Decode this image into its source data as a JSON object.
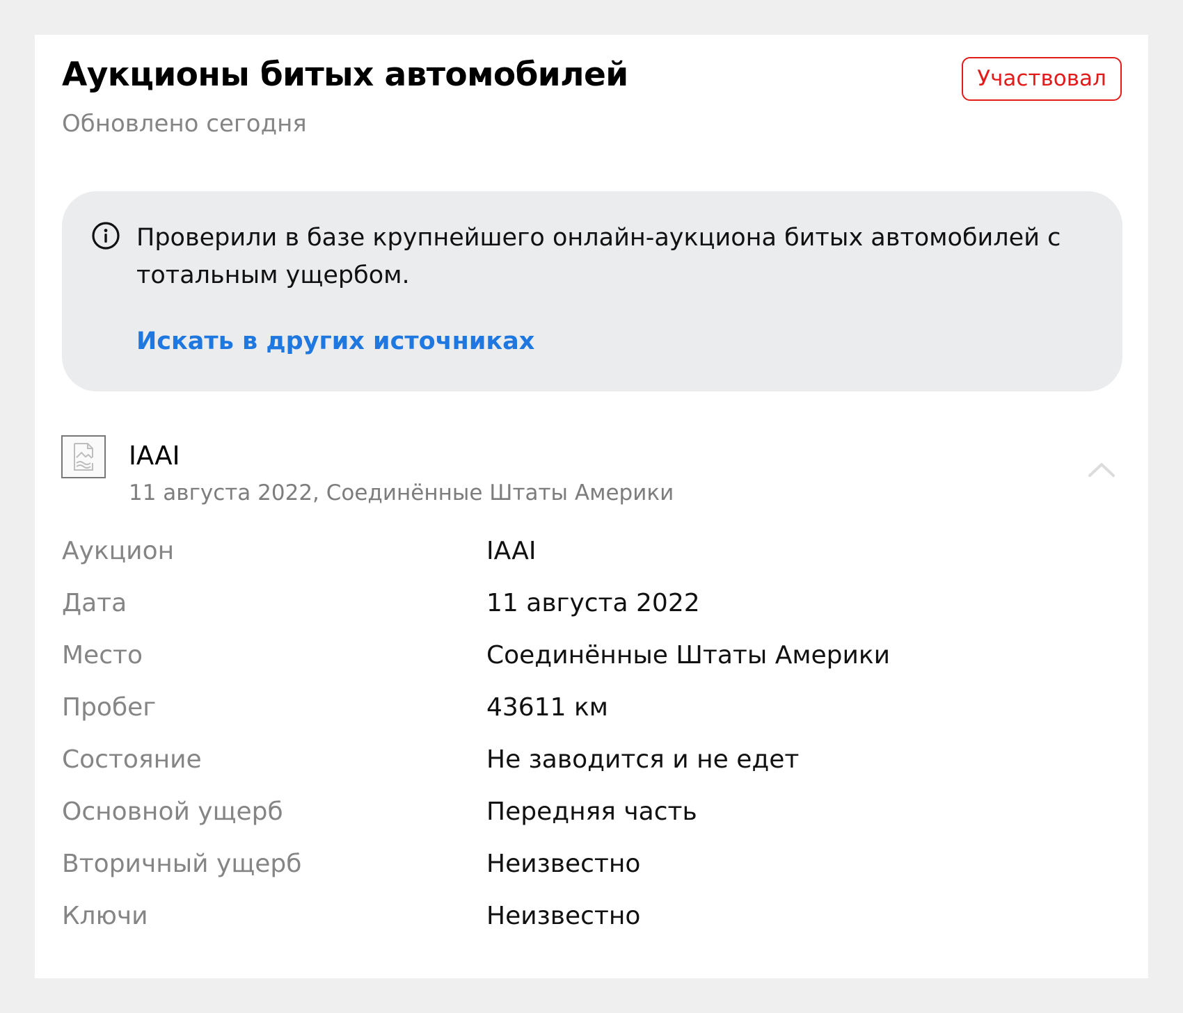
{
  "card": {
    "title": "Аукционы битых автомобилей",
    "updated": "Обновлено сегодня",
    "status_badge": "Участвовал"
  },
  "info": {
    "icon": "info-circle-icon",
    "text": "Проверили в базе крупнейшего онлайн-аукциона битых автомобилей с тотальным ущербом.",
    "link_label": "Искать в других источниках",
    "link_color": "#1f78e0"
  },
  "auction": {
    "thumbnail_icon": "broken-image-icon",
    "name": "IAAI",
    "subtitle": "11 августа 2022, Соединённые Штаты Америки",
    "toggle_icon": "chevron-up-icon",
    "details": [
      {
        "label": "Аукцион",
        "value": "IAAI"
      },
      {
        "label": "Дата",
        "value": "11 августа 2022"
      },
      {
        "label": "Место",
        "value": "Соединённые Штаты Америки"
      },
      {
        "label": "Пробег",
        "value": "43611 км"
      },
      {
        "label": "Состояние",
        "value": "Не заводится и не едет"
      },
      {
        "label": "Основной ущерб",
        "value": "Передняя часть"
      },
      {
        "label": "Вторичный ущерб",
        "value": "Неизвестно"
      },
      {
        "label": "Ключи",
        "value": "Неизвестно"
      }
    ]
  },
  "colors": {
    "badge": "#e21b1b",
    "page_background": "#efefef",
    "info_background": "#ebecee",
    "muted_text": "#858585"
  }
}
